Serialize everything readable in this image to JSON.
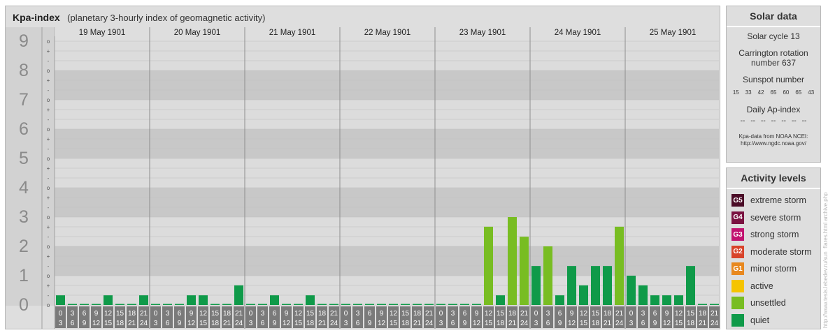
{
  "header": {
    "title": "Kpa-index",
    "subtitle": "(planetary 3-hourly index of geomagnetic activity)"
  },
  "chart_data": {
    "type": "bar",
    "ylim": [
      0,
      9
    ],
    "y_ticks": [
      "0",
      "1",
      "2",
      "3",
      "4",
      "5",
      "6",
      "7",
      "8",
      "9"
    ],
    "sub_ticks": [
      "o",
      "-",
      "+",
      "o",
      "-",
      "+",
      "o",
      "-",
      "+",
      "o",
      "-",
      "+",
      "o",
      "-",
      "+",
      "o",
      "-",
      "+",
      "o",
      "-",
      "+",
      "o",
      "-",
      "+",
      "o",
      "-",
      "+",
      "o"
    ],
    "days": [
      "19 May 1901",
      "20 May 1901",
      "21 May 1901",
      "22 May 1901",
      "23 May 1901",
      "24 May 1901",
      "25 May 1901"
    ],
    "hour_start": [
      "0",
      "3",
      "6",
      "9",
      "12",
      "15",
      "18",
      "21"
    ],
    "hour_end": [
      "3",
      "6",
      "9",
      "12",
      "15",
      "18",
      "21",
      "24"
    ],
    "values": [
      0.33,
      0,
      0,
      0,
      0.33,
      0,
      0,
      0.33,
      0,
      0,
      0,
      0.33,
      0.33,
      0,
      0,
      0.67,
      0,
      0,
      0.33,
      0,
      0,
      0.33,
      0,
      0,
      0,
      0,
      0,
      0,
      0,
      0,
      0,
      0,
      0,
      0,
      0,
      0,
      2.67,
      0.33,
      3.0,
      2.33,
      1.33,
      2.0,
      0.33,
      1.33,
      0.67,
      1.33,
      1.33,
      2.67,
      1.0,
      0.67,
      0.33,
      0.33,
      0.33,
      1.33,
      0,
      0
    ],
    "colors": {
      "quiet": "#0f9a49",
      "unsettled": "#78bd22"
    }
  },
  "solar_panel": {
    "title": "Solar data",
    "cycle": "Solar cycle 13",
    "carrington_line1": "Carrington rotation",
    "carrington_line2": "number 637",
    "sunspot_label": "Sunspot number",
    "sunspot_values": [
      "15",
      "33",
      "42",
      "65",
      "60",
      "65",
      "43"
    ],
    "ap_label": "Daily Ap-index",
    "ap_values": [
      "--",
      "--",
      "--",
      "--",
      "--",
      "--",
      "--"
    ],
    "source_line1": "Kpa-data from NOAA NCEI:",
    "source_line2": "http://www.ngdc.noaa.gov/"
  },
  "activity_panel": {
    "title": "Activity levels",
    "levels": [
      {
        "code": "G5",
        "label": "extreme storm",
        "color": "#4a0b26"
      },
      {
        "code": "G4",
        "label": "severe storm",
        "color": "#7a1240"
      },
      {
        "code": "G3",
        "label": "strong storm",
        "color": "#c21370"
      },
      {
        "code": "G2",
        "label": "moderate storm",
        "color": "#d8432a"
      },
      {
        "code": "G1",
        "label": "minor storm",
        "color": "#e8881e"
      },
      {
        "code": "",
        "label": "active",
        "color": "#f5c400"
      },
      {
        "code": "",
        "label": "unsettled",
        "color": "#78bd22"
      },
      {
        "code": "",
        "label": "quiet",
        "color": "#0f9a49"
      }
    ]
  },
  "watermark": "http://www.tesis.lebedev.ru/sun_flares.html archive.php"
}
